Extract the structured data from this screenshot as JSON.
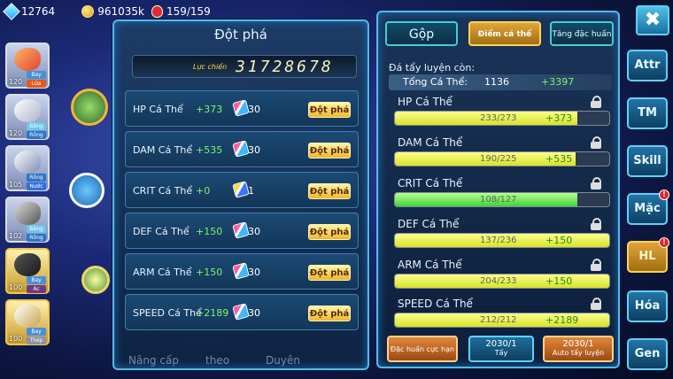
{
  "topbar": {
    "gems": "12764",
    "gold": "961035k",
    "stamina": "159/159"
  },
  "roster": [
    {
      "level": "120",
      "types": [
        "Bay",
        "Lửa"
      ]
    },
    {
      "level": "120",
      "types": [
        "Băng",
        "Rồng"
      ]
    },
    {
      "level": "105",
      "types": [
        "Rồng",
        "Nước"
      ]
    },
    {
      "level": "102",
      "types": [
        "Băng",
        "Rồng"
      ]
    },
    {
      "level": "100",
      "types": [
        "Bay",
        "Ác"
      ]
    },
    {
      "level": "100",
      "types": [
        "Bay",
        "Thép"
      ]
    }
  ],
  "breakthrough": {
    "title": "Đột phá",
    "power_label": "Lực chiến",
    "power_value": "31728678",
    "button_label": "Đột phá",
    "rows": [
      {
        "name": "HP Cá Thể",
        "bonus": "+373",
        "qty": "30"
      },
      {
        "name": "DAM Cá Thể",
        "bonus": "+535",
        "qty": "30"
      },
      {
        "name": "CRIT Cá Thể",
        "bonus": "+0",
        "qty": "1"
      },
      {
        "name": "DEF Cá Thể",
        "bonus": "+150",
        "qty": "30"
      },
      {
        "name": "ARM Cá Thể",
        "bonus": "+150",
        "qty": "30"
      },
      {
        "name": "SPEED Cá Thể",
        "bonus": "+2189",
        "qty": "30"
      }
    ]
  },
  "bottom_menu": [
    "Nâng cấp",
    "theo",
    "Duyên"
  ],
  "training": {
    "tabs": [
      "Gộp",
      "Điểm cá thể",
      "Tăng đặc huấn"
    ],
    "remaining_label": "Đá tẩy luyện còn:",
    "total": {
      "label": "Tổng Cá Thể:",
      "value": "1136",
      "bonus": "+3397"
    },
    "stats": [
      {
        "name": "HP Cá Thể",
        "value": "233/273",
        "bonus": "+373",
        "ratio": 0.853
      },
      {
        "name": "DAM Cá Thể",
        "value": "190/225",
        "bonus": "+535",
        "ratio": 0.844
      },
      {
        "name": "CRIT Cá Thể",
        "value": "108/127",
        "bonus": "",
        "ratio": 0.85
      },
      {
        "name": "DEF Cá Thể",
        "value": "137/236",
        "bonus": "+150",
        "ratio": 1.0
      },
      {
        "name": "ARM Cá Thể",
        "value": "204/233",
        "bonus": "+150",
        "ratio": 1.0
      },
      {
        "name": "SPEED Cá Thể",
        "value": "212/212",
        "bonus": "+2189",
        "ratio": 1.0
      }
    ],
    "buttons": {
      "special": "Đặc huấn cực hạn",
      "wash_count": "2030/1",
      "wash_label": "Tẩy",
      "auto_count": "2030/1",
      "auto_label": "Auto tẩy luyện"
    }
  },
  "side_tabs": [
    "Attr",
    "TM",
    "Skill",
    "Mặc",
    "HL",
    "Hóa",
    "Gen"
  ],
  "alert_mark": "!",
  "close_label": "✖"
}
